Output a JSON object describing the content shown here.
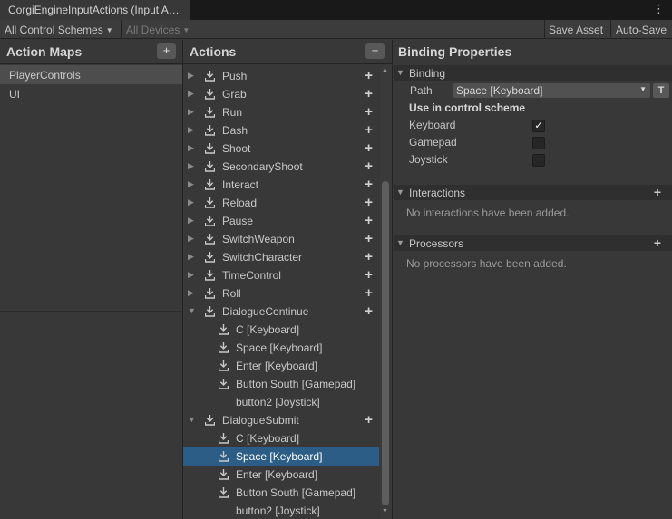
{
  "window": {
    "tab_title": "CorgiEngineInputActions (Input A…",
    "menu_icon": "kebab-icon"
  },
  "toolbar": {
    "control_schemes": "All Control Schemes",
    "devices": "All Devices",
    "save_asset": "Save Asset",
    "auto_save": "Auto-Save"
  },
  "action_maps": {
    "title": "Action Maps",
    "add_label": "+",
    "items": [
      {
        "label": "PlayerControls",
        "selected": true
      },
      {
        "label": "UI",
        "selected": false
      }
    ]
  },
  "actions": {
    "title": "Actions",
    "add_label": "+",
    "rows": [
      {
        "label": "Push",
        "type": "action",
        "expanded": false
      },
      {
        "label": "Grab",
        "type": "action",
        "expanded": false
      },
      {
        "label": "Run",
        "type": "action",
        "expanded": false
      },
      {
        "label": "Dash",
        "type": "action",
        "expanded": false
      },
      {
        "label": "Shoot",
        "type": "action",
        "expanded": false
      },
      {
        "label": "SecondaryShoot",
        "type": "action",
        "expanded": false
      },
      {
        "label": "Interact",
        "type": "action",
        "expanded": false
      },
      {
        "label": "Reload",
        "type": "action",
        "expanded": false
      },
      {
        "label": "Pause",
        "type": "action",
        "expanded": false
      },
      {
        "label": "SwitchWeapon",
        "type": "action",
        "expanded": false
      },
      {
        "label": "SwitchCharacter",
        "type": "action",
        "expanded": false
      },
      {
        "label": "TimeControl",
        "type": "action",
        "expanded": false
      },
      {
        "label": "Roll",
        "type": "action",
        "expanded": false
      },
      {
        "label": "DialogueContinue",
        "type": "action",
        "expanded": true
      },
      {
        "label": "C [Keyboard]",
        "type": "binding",
        "icon": true
      },
      {
        "label": "Space [Keyboard]",
        "type": "binding",
        "icon": true
      },
      {
        "label": "Enter [Keyboard]",
        "type": "binding",
        "icon": true
      },
      {
        "label": "Button South [Gamepad]",
        "type": "binding",
        "icon": true
      },
      {
        "label": "button2 [Joystick]",
        "type": "binding",
        "icon": false
      },
      {
        "label": "DialogueSubmit",
        "type": "action",
        "expanded": true
      },
      {
        "label": "C [Keyboard]",
        "type": "binding",
        "icon": true
      },
      {
        "label": "Space [Keyboard]",
        "type": "binding",
        "icon": true,
        "selected": true
      },
      {
        "label": "Enter [Keyboard]",
        "type": "binding",
        "icon": true
      },
      {
        "label": "Button South [Gamepad]",
        "type": "binding",
        "icon": true
      },
      {
        "label": "button2 [Joystick]",
        "type": "binding",
        "icon": false
      }
    ]
  },
  "binding_properties": {
    "title": "Binding Properties",
    "binding_section": "Binding",
    "path_label": "Path",
    "path_value": "Space [Keyboard]",
    "t_button": "T",
    "use_in_scheme": "Use in control scheme",
    "schemes": [
      {
        "label": "Keyboard",
        "checked": true
      },
      {
        "label": "Gamepad",
        "checked": false
      },
      {
        "label": "Joystick",
        "checked": false
      }
    ],
    "interactions_section": "Interactions",
    "interactions_empty": "No interactions have been added.",
    "processors_section": "Processors",
    "processors_empty": "No processors have been added.",
    "add_label": "+"
  },
  "colors": {
    "selection": "#2c5d87",
    "background": "#383838",
    "titlebar": "#191919"
  }
}
